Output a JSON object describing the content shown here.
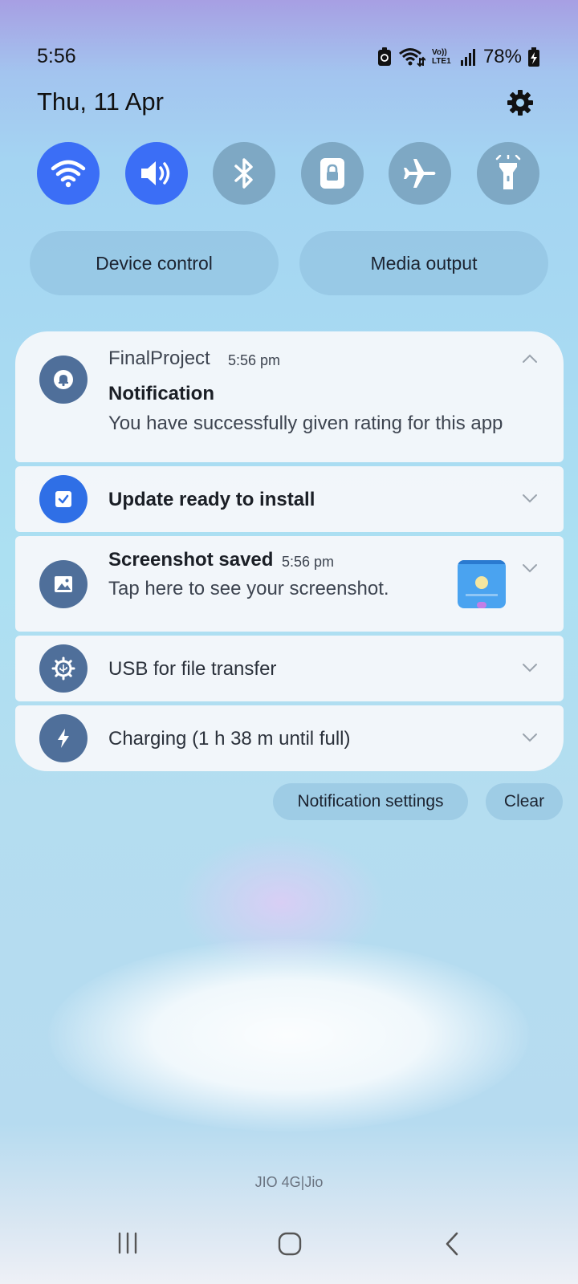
{
  "status_bar": {
    "time": "5:56",
    "battery_percent": "78%",
    "network_label": "Vo)) LTE1"
  },
  "header": {
    "date": "Thu, 11 Apr"
  },
  "quick_settings": [
    {
      "name": "wifi",
      "icon": "wifi-icon",
      "active": true
    },
    {
      "name": "sound",
      "icon": "volume-icon",
      "active": true
    },
    {
      "name": "bluetooth",
      "icon": "bluetooth-icon",
      "active": false
    },
    {
      "name": "rotation-lock",
      "icon": "lock-icon",
      "active": false
    },
    {
      "name": "airplane-mode",
      "icon": "airplane-icon",
      "active": false
    },
    {
      "name": "flashlight",
      "icon": "flashlight-icon",
      "active": false
    }
  ],
  "panel_buttons": {
    "device_control": "Device control",
    "media_output": "Media output"
  },
  "notifications": [
    {
      "app": "FinalProject",
      "time": "5:56 pm",
      "title": "Notification",
      "body": "You have successfully given rating for this app",
      "icon": "bell-icon",
      "expanded": true
    },
    {
      "title": "Update ready to install",
      "icon": "checkbox-icon"
    },
    {
      "title": "Screenshot saved",
      "time": "5:56 pm",
      "body": "Tap here to see your screenshot.",
      "icon": "image-icon",
      "thumbnail": "screenshot-thumbnail"
    },
    {
      "title": "USB for file transfer",
      "icon": "usb-settings-icon"
    },
    {
      "title": "Charging (1 h 38 m until full)",
      "icon": "bolt-icon"
    }
  ],
  "notification_actions": {
    "settings": "Notification settings",
    "clear": "Clear"
  },
  "carrier": "JIO 4G|Jio",
  "colors": {
    "active_tile": "#3b6ef6",
    "inactive_tile": "#7ea8c4",
    "app_icon": "#4f6f9a"
  }
}
